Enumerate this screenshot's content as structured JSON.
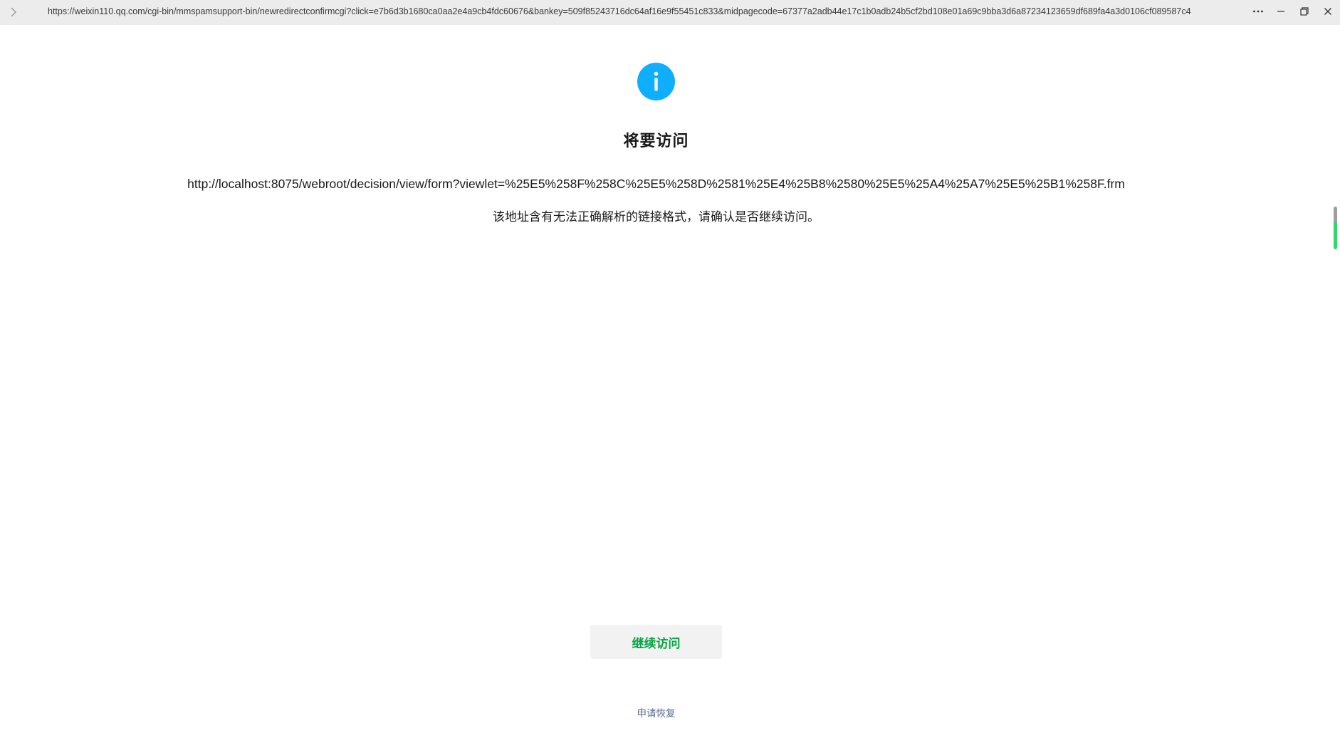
{
  "browser": {
    "address_bar_url": "https://weixin110.qq.com/cgi-bin/mmspamsupport-bin/newredirectconfirmcgi?click=e7b6d3b1680ca0aa2e4a9cb4fdc60676&bankey=509f85243716dc64af16e9f55451c833&midpagecode=67377a2adb44e17c1b0adb24b5cf2bd108e01a69c9bba3d6a87234123659df689fa4a3d0106cf089587c4",
    "icons": {
      "forward": "chevron-right-icon",
      "more": "more-horizontal-icon",
      "minimize": "minimize-icon",
      "restore": "restore-window-icon",
      "close": "close-icon"
    }
  },
  "page": {
    "icon": "info-icon",
    "icon_color": "#10aeff",
    "title": "将要访问",
    "target_url": "http://localhost:8075/webroot/decision/view/form?viewlet=%25E5%258F%258C%25E5%258D%2581%25E4%25B8%2580%25E5%25A4%25A7%25E5%25B1%258F.frm",
    "warning": "该地址含有无法正确解析的链接格式，请确认是否继续访问。",
    "continue_button": "继续访问",
    "continue_color": "#07a544",
    "appeal_link": "申请恢复",
    "link_color": "#576b95"
  }
}
